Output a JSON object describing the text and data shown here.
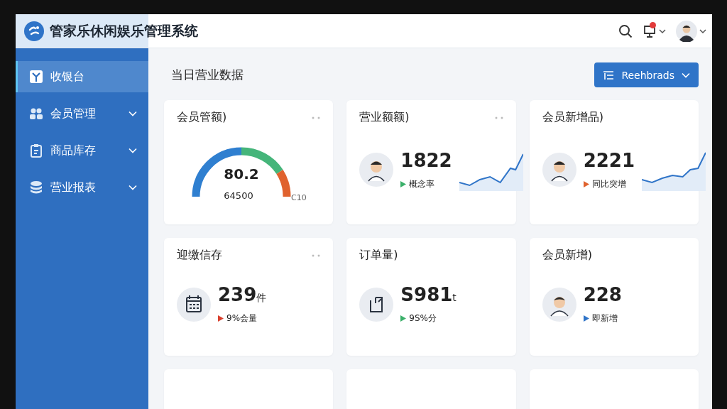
{
  "app": {
    "title": "管家乐休闲娱乐管理系统"
  },
  "topbar": {
    "notification_badge": true
  },
  "sidebar": {
    "items": [
      {
        "label": "收银台",
        "kind": "link",
        "selected": true
      },
      {
        "label": "会员管理",
        "kind": "group",
        "selected": false
      },
      {
        "label": "商品库存",
        "kind": "group",
        "selected": false
      },
      {
        "label": "营业报表",
        "kind": "group",
        "selected": false
      }
    ]
  },
  "page": {
    "title": "当日营业数据",
    "button": "Reehbrads"
  },
  "cards": [
    {
      "kind": "gauge",
      "title": "会员管额)",
      "has_menu": true,
      "value": "80.2",
      "sub": "64500",
      "max": "C10"
    },
    {
      "kind": "sparkline",
      "title": "营业额额)",
      "has_menu": true,
      "value": "1822",
      "trend": "概念率",
      "color": "#3bb06a"
    },
    {
      "kind": "sparkline",
      "title": "会员新增品)",
      "has_menu": false,
      "value": "2221",
      "trend": "同比突增",
      "color": "#e0622e"
    },
    {
      "kind": "stat",
      "title": "迎缴信存",
      "has_menu": true,
      "value": "239",
      "unit": "件",
      "trend": "9%会量",
      "color": "#d9402e"
    },
    {
      "kind": "stat",
      "title": "订单量)",
      "has_menu": false,
      "value": "S981",
      "unit": "t",
      "trend": "9S%分",
      "color": "#3bb06a"
    },
    {
      "kind": "stat",
      "title": "会员新增)",
      "has_menu": false,
      "value": "228",
      "trend": "即新增",
      "color": "#2f74c8"
    },
    {
      "kind": "blank"
    },
    {
      "kind": "blank"
    },
    {
      "kind": "blank"
    }
  ]
}
